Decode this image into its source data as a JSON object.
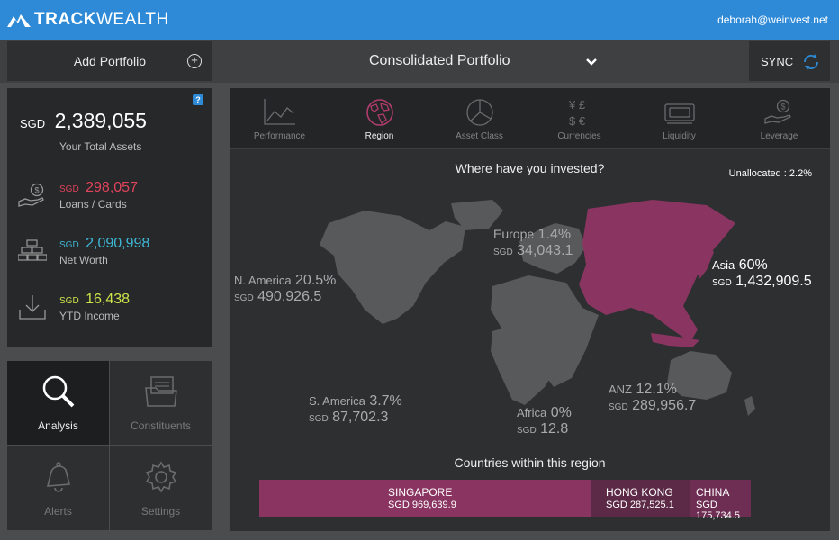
{
  "brand": {
    "name_bold": "TRACK",
    "name_light": "WEALTH"
  },
  "user": {
    "email": "deborah@weinvest.net"
  },
  "toolbar": {
    "add_portfolio": "Add Portfolio",
    "portfolio": "Consolidated Portfolio",
    "sync": "SYNC"
  },
  "summary": {
    "help": "?",
    "total_currency": "SGD",
    "total_value": "2,389,055",
    "total_label": "Your Total Assets",
    "stats": [
      {
        "currency": "SGD",
        "value": "298,057",
        "label": "Loans / Cards",
        "color": "#e0435b",
        "icon": "money-hand-icon"
      },
      {
        "currency": "SGD",
        "value": "2,090,998",
        "label": "Net Worth",
        "color": "#3fb8d8",
        "icon": "gold-bars-icon"
      },
      {
        "currency": "SGD",
        "value": "16,438",
        "label": "YTD Income",
        "color": "#cfe34a",
        "icon": "download-tray-icon"
      }
    ]
  },
  "nav": [
    {
      "label": "Analysis",
      "active": true
    },
    {
      "label": "Constituents",
      "active": false
    },
    {
      "label": "Alerts",
      "active": false
    },
    {
      "label": "Settings",
      "active": false
    }
  ],
  "tabs": [
    {
      "label": "Performance"
    },
    {
      "label": "Region"
    },
    {
      "label": "Asset Class"
    },
    {
      "label": "Currencies"
    },
    {
      "label": "Liquidity"
    },
    {
      "label": "Leverage"
    }
  ],
  "region": {
    "title": "Where have you invested?",
    "unallocated": "Unallocated : 2.2%",
    "regions": [
      {
        "name": "Europe",
        "pct": "1.4%",
        "currency": "SGD",
        "value": "34,043.1"
      },
      {
        "name": "N. America",
        "pct": "20.5%",
        "currency": "SGD",
        "value": "490,926.5"
      },
      {
        "name": "Asia",
        "pct": "60%",
        "currency": "SGD",
        "value": "1,432,909.5"
      },
      {
        "name": "S. America",
        "pct": "3.7%",
        "currency": "SGD",
        "value": "87,702.3"
      },
      {
        "name": "Africa",
        "pct": "0%",
        "currency": "SGD",
        "value": "12.8"
      },
      {
        "name": "ANZ",
        "pct": "12.1%",
        "currency": "SGD",
        "value": "289,956.7"
      }
    ],
    "countries_title": "Countries within this region",
    "countries": [
      {
        "name": "SINGAPORE",
        "value": "SGD 969,639.9",
        "share": 0.656,
        "color": "#8a3561"
      },
      {
        "name": "HONG KONG",
        "value": "SGD 287,525.1",
        "share": 0.195,
        "color": "#5c2a46"
      },
      {
        "name": "CHINA",
        "value": "SGD 175,734.5",
        "share": 0.119,
        "color": "#6e2d52"
      }
    ],
    "highlight_color": "#8a3561"
  }
}
